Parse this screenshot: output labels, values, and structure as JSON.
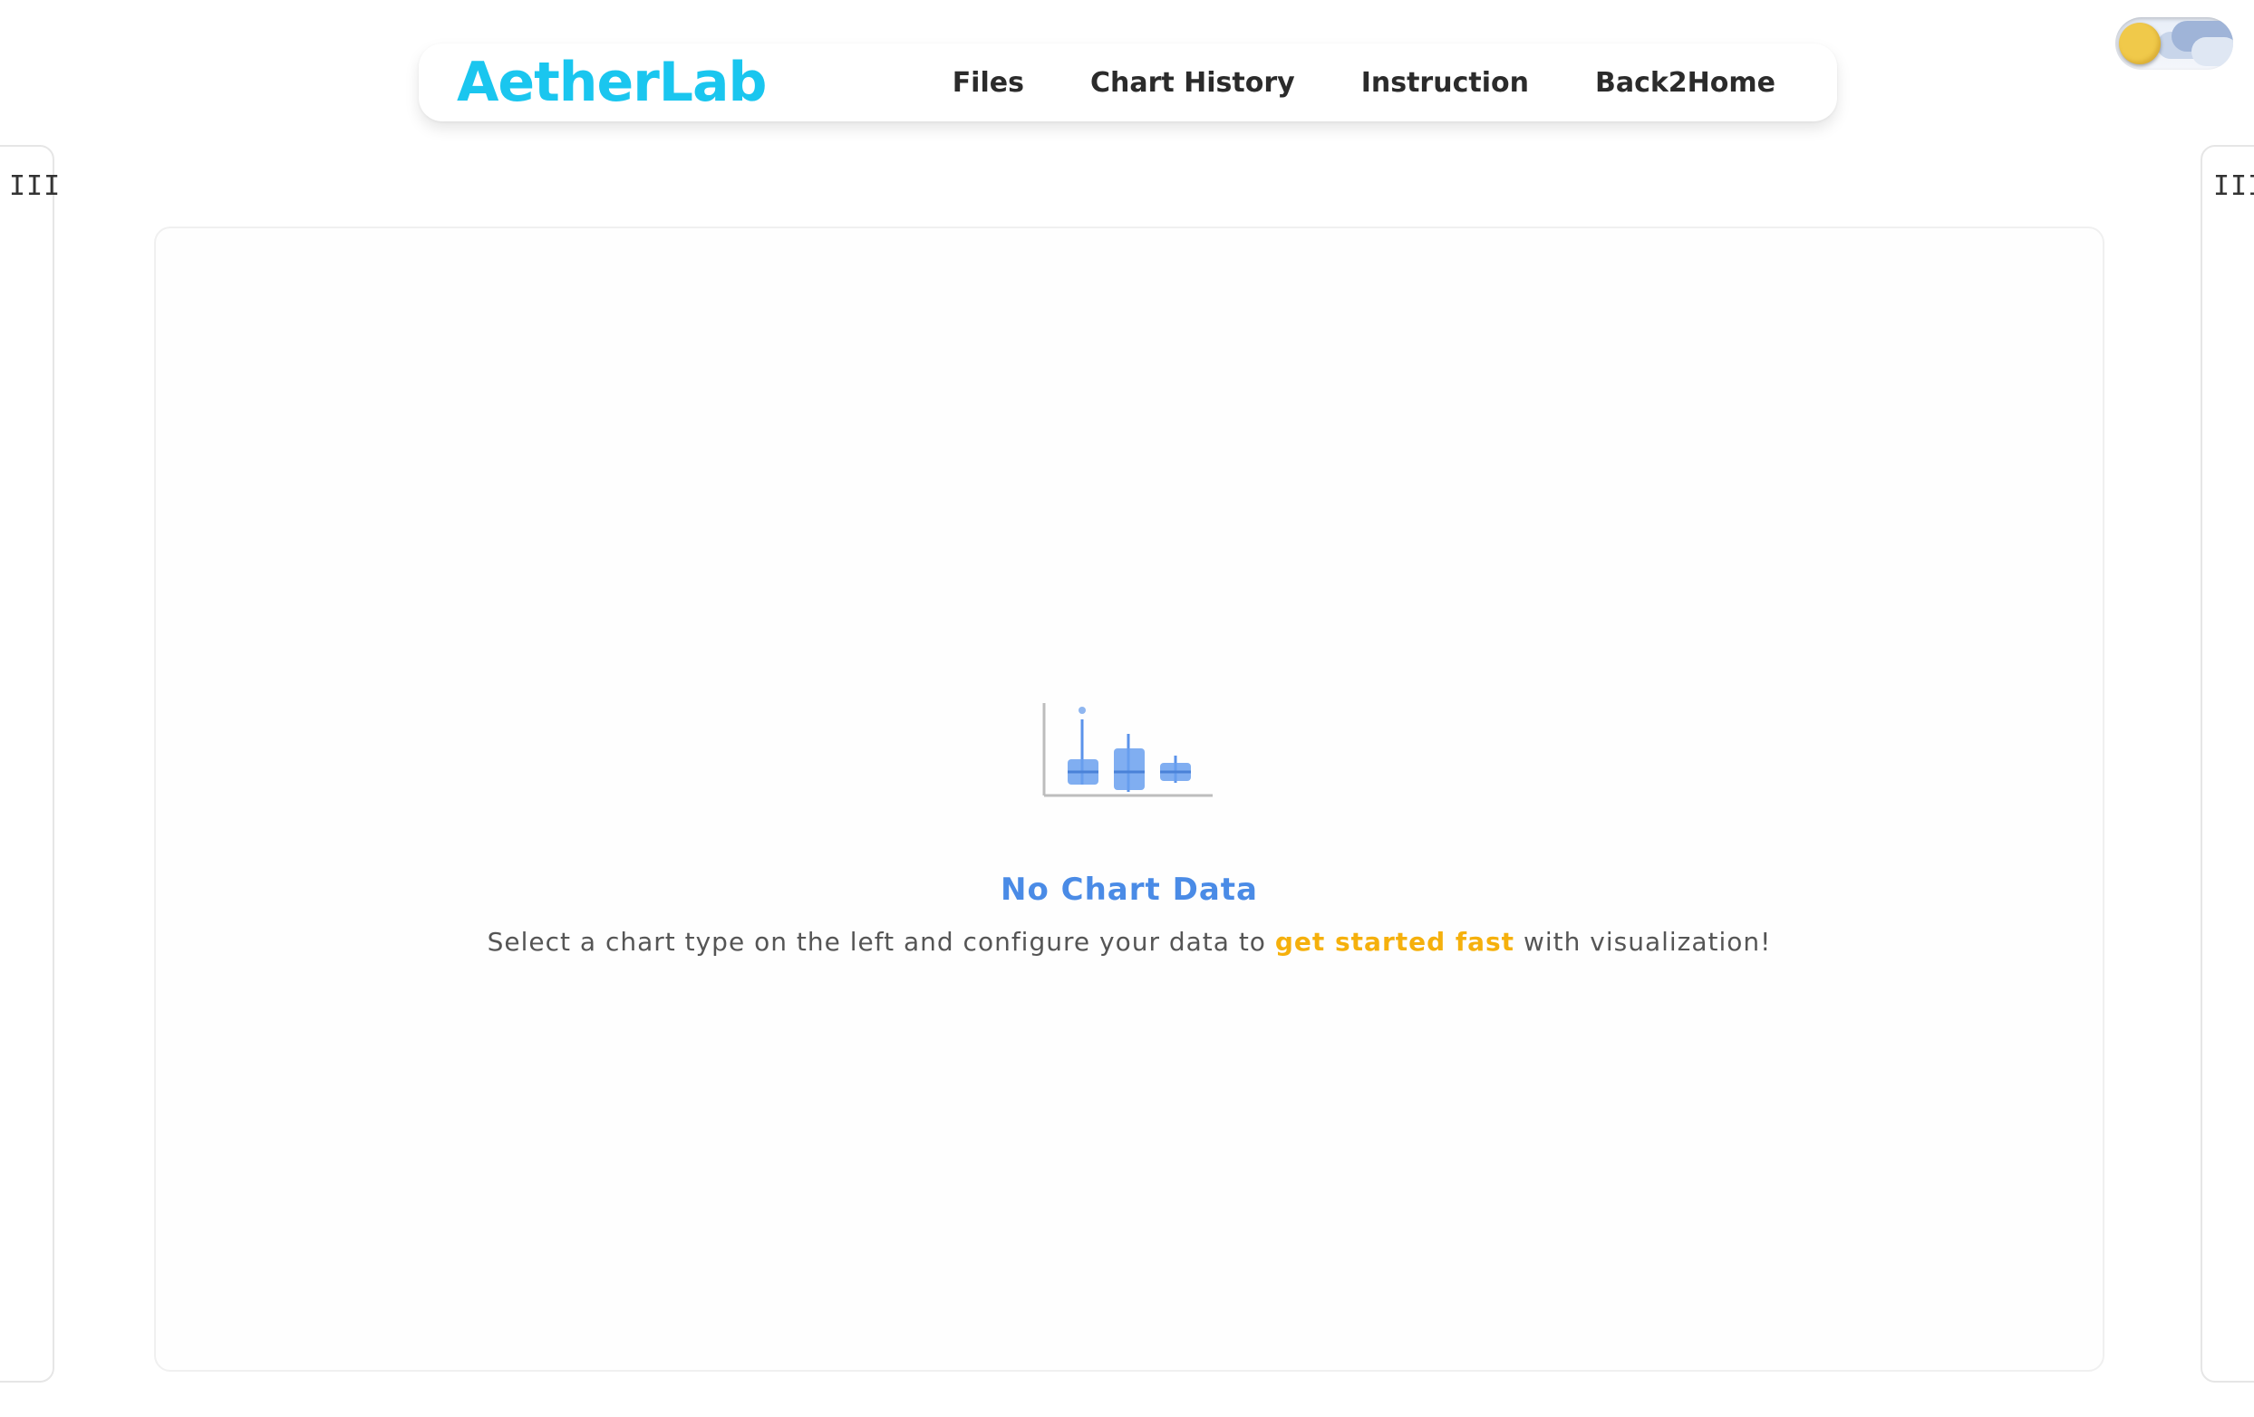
{
  "app": {
    "logo": "AetherLab"
  },
  "nav": {
    "items": [
      {
        "label": "Files"
      },
      {
        "label": "Chart History"
      },
      {
        "label": "Instruction"
      },
      {
        "label": "Back2Home"
      }
    ]
  },
  "theme_toggle": {
    "state": "light",
    "icon": "sun-icon"
  },
  "left_panel": {
    "toggle_label": "III"
  },
  "right_panel": {
    "toggle_label": "III"
  },
  "empty_state": {
    "icon": "boxplot-chart-icon",
    "title": "No Chart Data",
    "desc_prefix": "Select a chart type on the left and configure your data to ",
    "desc_highlight": "get started fast",
    "desc_suffix": " with visualization!"
  },
  "colors": {
    "logo": "#1ac6ef",
    "title": "#4a8be6",
    "highlight": "#f5b00c",
    "icon_fill": "#5b93ea"
  }
}
